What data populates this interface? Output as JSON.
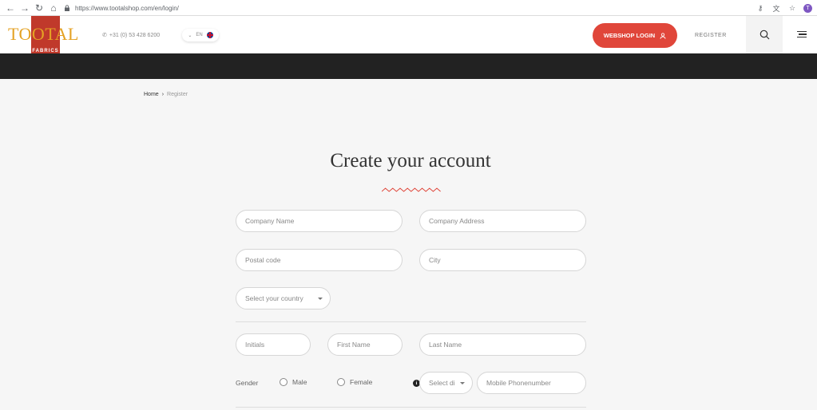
{
  "browser": {
    "url_scheme_host": "https://www.tootalshop.com",
    "url_path": "/en/login/",
    "profile_initial": "T"
  },
  "header": {
    "logo_text": "TOOTAL",
    "logo_sub": "FABRICS",
    "phone": "+31 (0) 53 428 6200",
    "lang": "EN",
    "webshop_login": "WEBSHOP LOGIN",
    "register": "REGISTER"
  },
  "breadcrumb": {
    "home": "Home",
    "separator": "›",
    "current": "Register"
  },
  "page": {
    "title": "Create your account"
  },
  "form": {
    "company_name": "Company Name",
    "company_address": "Company Address",
    "postal_code": "Postal code",
    "city": "City",
    "country": "Select your country",
    "initials": "Initials",
    "first_name": "First Name",
    "last_name": "Last Name",
    "gender_label": "Gender",
    "male": "Male",
    "female": "Female",
    "dial_code": "Select di",
    "mobile": "Mobile Phonenumber"
  },
  "colors": {
    "accent": "#e0463a",
    "logo_gold": "#e4a224",
    "logo_red": "#c0392b",
    "dark_band": "#222222"
  },
  "icons": [
    "back-icon",
    "forward-icon",
    "reload-icon",
    "home-icon",
    "lock-icon",
    "key-icon",
    "translate-icon",
    "star-icon",
    "phone-icon",
    "chevron-down-icon",
    "flag-uk-icon",
    "user-icon",
    "search-icon",
    "menu-icon",
    "chevron-right-icon",
    "info-icon"
  ]
}
